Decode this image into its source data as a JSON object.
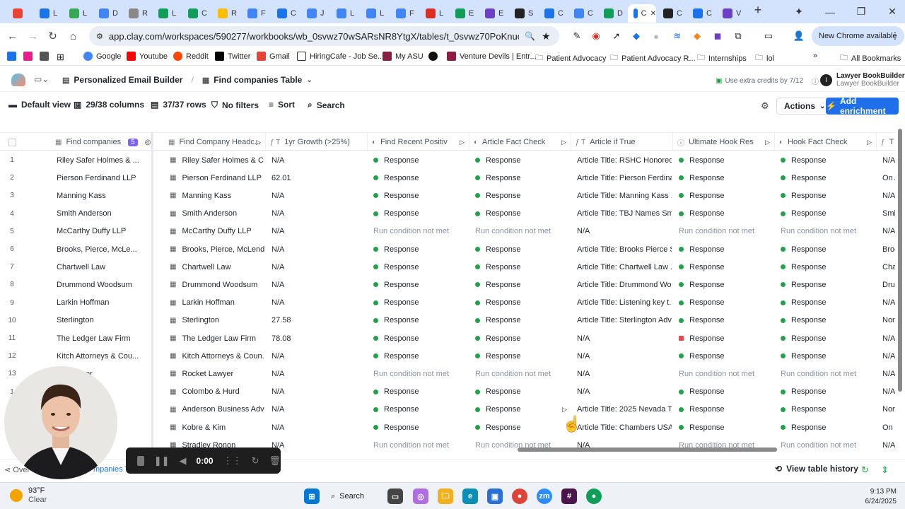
{
  "browser": {
    "tabs": [
      {
        "icon": "gmail-icon",
        "label": "",
        "color": "#ea4335"
      },
      {
        "icon": "sheets-icon",
        "label": "L",
        "color": "#1a73e8"
      },
      {
        "icon": "drive-icon",
        "label": "L",
        "color": "#34a853"
      },
      {
        "icon": "doc-icon",
        "label": "D",
        "color": "#4285f4"
      },
      {
        "icon": "gear-icon",
        "label": "R",
        "color": "#888888"
      },
      {
        "icon": "sheets-icon",
        "label": "L",
        "color": "#0f9d58"
      },
      {
        "icon": "sheets-icon",
        "label": "C",
        "color": "#0f9d58"
      },
      {
        "icon": "drive-icon",
        "label": "R",
        "color": "#fbbc04"
      },
      {
        "icon": "doc-icon",
        "label": "F",
        "color": "#4285f4"
      },
      {
        "icon": "star-icon",
        "label": "C",
        "color": "#1a73e8"
      },
      {
        "icon": "doc-icon",
        "label": "J",
        "color": "#4285f4"
      },
      {
        "icon": "doc-icon",
        "label": "L",
        "color": "#4285f4"
      },
      {
        "icon": "doc-icon",
        "label": "L",
        "color": "#4285f4"
      },
      {
        "icon": "doc-icon",
        "label": "F",
        "color": "#4285f4"
      },
      {
        "icon": "pdf-icon",
        "label": "L",
        "color": "#d93025"
      },
      {
        "icon": "sheets-icon",
        "label": "E",
        "color": "#0f9d58"
      },
      {
        "icon": "app-icon",
        "label": "E",
        "color": "#6c3fc5"
      },
      {
        "icon": "app-icon",
        "label": "S",
        "color": "#222222"
      },
      {
        "icon": "slides-icon",
        "label": "C",
        "color": "#1a73e8"
      },
      {
        "icon": "doc-icon",
        "label": "C",
        "color": "#4285f4"
      },
      {
        "icon": "sheets-icon",
        "label": "D",
        "color": "#0f9d58"
      },
      {
        "icon": "clay-icon",
        "label": "C",
        "color": "#ffffff",
        "active": true
      },
      {
        "icon": "app-icon",
        "label": "C",
        "color": "#222222"
      },
      {
        "icon": "app-icon",
        "label": "C",
        "color": "#1a73e8"
      },
      {
        "icon": "gear-icon",
        "label": "V",
        "color": "#6c3fc5"
      }
    ],
    "url": "app.clay.com/workspaces/590277/workbooks/wb_0svwz70wSARsNR8YtgX/tables/t_0svwz70PoKnuoNbUdgG/views...",
    "chrome_available": "New Chrome available",
    "bookmarks": [
      "Google",
      "Youtube",
      "Reddit",
      "Twitter",
      "Gmail",
      "HiringCafe - Job Se...",
      "My ASU",
      "Venture Devils | Entr...",
      "Patient Advocacy",
      "Patient Advocacy R...",
      "Internships",
      "lol",
      "All Bookmarks"
    ]
  },
  "app": {
    "breadcrumb": [
      "Personalized Email Builder",
      "Find companies Table"
    ],
    "credits": "Use extra credits by 7/12",
    "user_name": "Lawyer BookBuilder",
    "user_org": "Lawyer BookBuilder",
    "user_initial": "I",
    "toolbar": {
      "view": "Default view",
      "columns": "29/38 columns",
      "rows": "37/37 rows",
      "filters": "No filters",
      "sort": "Sort",
      "search": "Search",
      "actions": "Actions",
      "add_enrichment": "Add enrichment"
    },
    "accent": "#1f6feb"
  },
  "table": {
    "columns": [
      {
        "label": "Find companies",
        "badge": "5"
      },
      {
        "label": "Find Company Headc..."
      },
      {
        "label": "1yr Growth (>25%)"
      },
      {
        "label": "Find Recent Positiv"
      },
      {
        "label": "Article Fact Check"
      },
      {
        "label": "Article if True"
      },
      {
        "label": "Ultimate Hook Res"
      },
      {
        "label": "Hook Fact Check"
      },
      {
        "label": "T"
      }
    ],
    "rows": [
      {
        "n": "1",
        "company": "Riley Safer Holmes & ...",
        "headc": "Riley Safer Holmes & C...",
        "growth": "N/A",
        "recent": "Response",
        "fact": "Response",
        "article": "Article Title: RSHC Honored...",
        "hook": "Response",
        "hookfact": "Response",
        "last": "N/A"
      },
      {
        "n": "2",
        "company": "Pierson Ferdinand LLP",
        "headc": "Pierson Ferdinand LLP",
        "growth": "62.01",
        "recent": "Response",
        "fact": "Response",
        "article": "Article Title: Pierson Ferdina...",
        "hook": "Response",
        "hookfact": "Response",
        "last": "On A"
      },
      {
        "n": "3",
        "company": "Manning Kass",
        "headc": "Manning Kass",
        "growth": "N/A",
        "recent": "Response",
        "fact": "Response",
        "article": "Article Title: Manning Kass ...",
        "hook": "Response",
        "hookfact": "Response",
        "last": "N/A"
      },
      {
        "n": "4",
        "company": "Smith Anderson",
        "headc": "Smith Anderson",
        "growth": "N/A",
        "recent": "Response",
        "fact": "Response",
        "article": "Article Title: TBJ Names Smi...",
        "hook": "Response",
        "hookfact": "Response",
        "last": "Smitl"
      },
      {
        "n": "5",
        "company": "McCarthy Duffy LLP",
        "headc": "McCarthy Duffy LLP",
        "growth": "N/A",
        "recent": "Run condition not met",
        "fact": "Run condition not met",
        "article": "N/A",
        "hook": "Run condition not met",
        "hookfact": "Run condition not met",
        "last": "N/A"
      },
      {
        "n": "6",
        "company": "Brooks, Pierce, McLe...",
        "headc": "Brooks, Pierce, McLend...",
        "growth": "N/A",
        "recent": "Response",
        "fact": "Response",
        "article": "Article Title: Brooks Pierce S...",
        "hook": "Response",
        "hookfact": "Response",
        "last": "Broo"
      },
      {
        "n": "7",
        "company": "Chartwell Law",
        "headc": "Chartwell Law",
        "growth": "N/A",
        "recent": "Response",
        "fact": "Response",
        "article": "Article Title: Chartwell Law ...",
        "hook": "Response",
        "hookfact": "Response",
        "last": "Char"
      },
      {
        "n": "8",
        "company": "Drummond Woodsum",
        "headc": "Drummond Woodsum",
        "growth": "N/A",
        "recent": "Response",
        "fact": "Response",
        "article": "Article Title: Drummond Wo...",
        "hook": "Response",
        "hookfact": "Response",
        "last": "Drum"
      },
      {
        "n": "9",
        "company": "Larkin Hoffman",
        "headc": "Larkin Hoffman",
        "growth": "N/A",
        "recent": "Response",
        "fact": "Response",
        "article": "Article Title: Listening key t...",
        "hook": "Response",
        "hookfact": "Response",
        "last": "N/A"
      },
      {
        "n": "10",
        "company": "Sterlington",
        "headc": "Sterlington",
        "growth": "27.58",
        "recent": "Response",
        "fact": "Response",
        "article": "Article Title: Sterlington Adv...",
        "hook": "Response",
        "hookfact": "Response",
        "last": "None"
      },
      {
        "n": "11",
        "company": "The Ledger Law Firm",
        "headc": "The Ledger Law Firm",
        "growth": "78.08",
        "recent": "Response",
        "fact": "Response",
        "article": "N/A",
        "hook": "Response",
        "hook_red": true,
        "hookfact": "Response",
        "last": "N/A"
      },
      {
        "n": "12",
        "company": "Kitch Attorneys & Cou...",
        "headc": "Kitch Attorneys & Coun...",
        "growth": "N/A",
        "recent": "Response",
        "fact": "Response",
        "article": "N/A",
        "hook": "Response",
        "hookfact": "Response",
        "last": "N/A"
      },
      {
        "n": "13",
        "company": "...t Lawyer",
        "headc": "Rocket Lawyer",
        "growth": "N/A",
        "recent": "Run condition not met",
        "fact": "Run condition not met",
        "article": "N/A",
        "hook": "Run condition not met",
        "hookfact": "Run condition not met",
        "last": "N/A"
      },
      {
        "n": "1",
        "company": "...Hurd",
        "headc": "Colombo & Hurd",
        "growth": "N/A",
        "recent": "Response",
        "fact": "Response",
        "article": "N/A",
        "hook": "Response",
        "hookfact": "Response",
        "last": "N/A"
      },
      {
        "n": "",
        "company": "...ness A...",
        "headc": "Anderson Business Advi...",
        "growth": "N/A",
        "recent": "Response",
        "fact": "Response",
        "article": "Article Title: 2025 Nevada T...",
        "hook": "Response",
        "hookfact": "Response",
        "last": "None"
      },
      {
        "n": "",
        "company": "",
        "headc": "Kobre & Kim",
        "growth": "N/A",
        "recent": "Response",
        "fact": "Response",
        "article": "Article Title: Chambers USA ...",
        "hook": "Response",
        "hookfact": "Response",
        "last": "On F"
      },
      {
        "n": "",
        "company": "...n",
        "headc": "Stradley Ronon",
        "growth": "N/A",
        "recent": "Run condition not met",
        "fact": "Run condition not met",
        "article": "N/A",
        "hook": "Run condition not met",
        "hookfact": "Run condition not met",
        "last": "N/A"
      }
    ]
  },
  "footer": {
    "left": "Over",
    "tab": "mpanies Tab",
    "history": "View table history"
  },
  "recorder": {
    "time": "0:00"
  },
  "taskbar": {
    "temp": "93°F",
    "condition": "Clear",
    "search": "Search",
    "time": "9:13 PM",
    "date": "6/24/2025"
  }
}
